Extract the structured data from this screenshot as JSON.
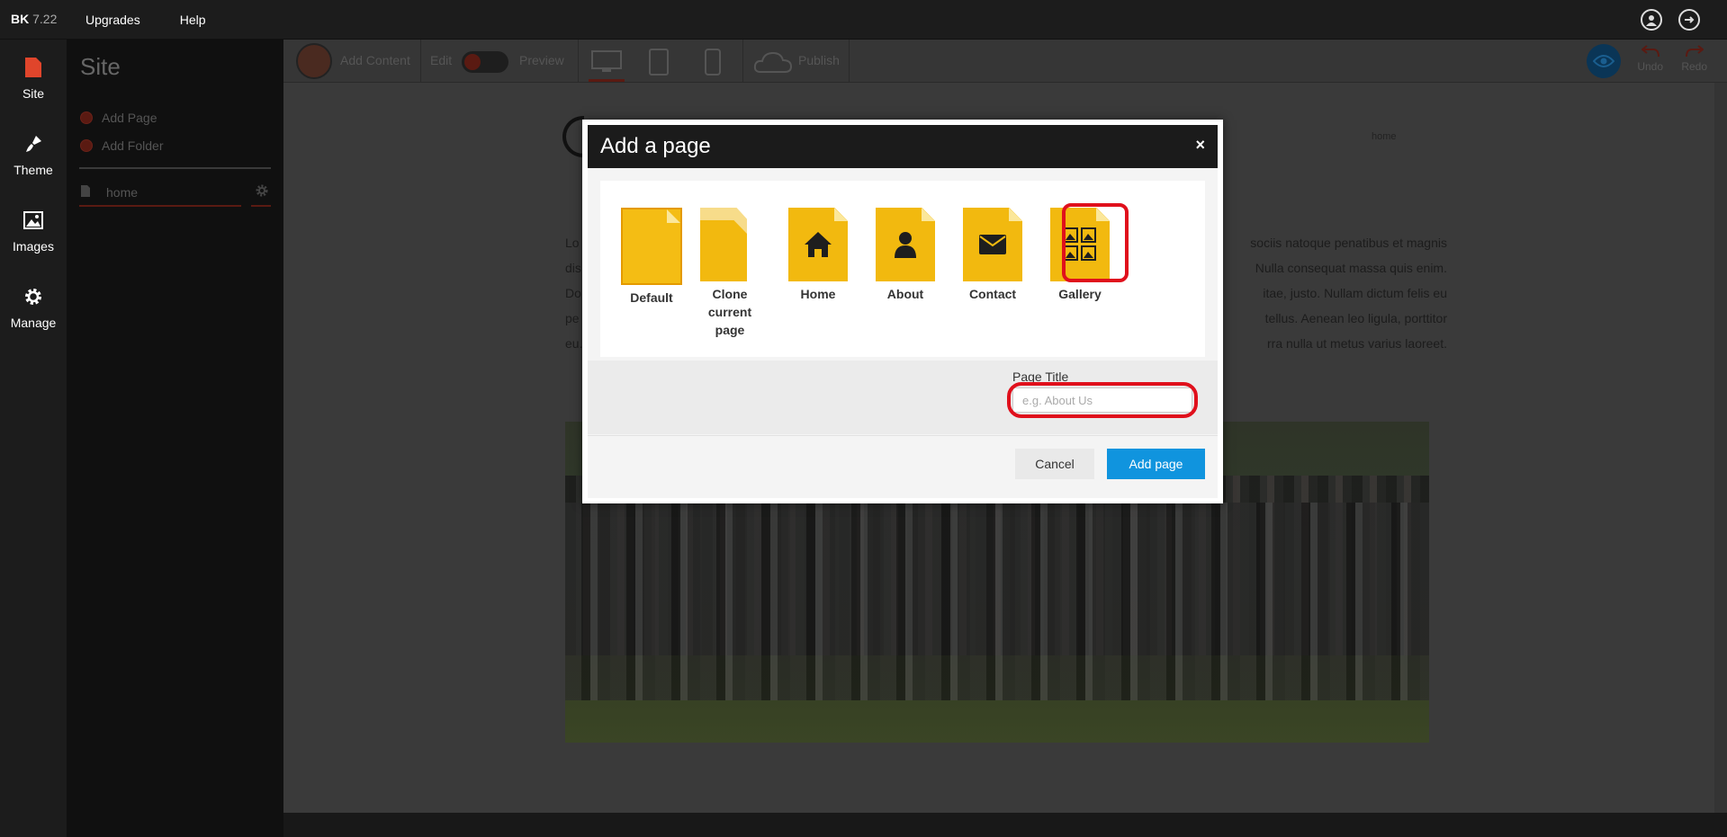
{
  "brand": {
    "short": "BK",
    "version": "7.22"
  },
  "topnav": {
    "upgrades": "Upgrades",
    "help": "Help"
  },
  "rail": {
    "site": "Site",
    "theme": "Theme",
    "images": "Images",
    "manage": "Manage"
  },
  "panel": {
    "title": "Site",
    "add_page": "Add Page",
    "add_folder": "Add Folder",
    "home_page": "home"
  },
  "toolbar": {
    "add_content": "Add Content",
    "edit": "Edit",
    "preview": "Preview",
    "publish": "Publish",
    "undo": "Undo",
    "redo": "Redo"
  },
  "page_preview": {
    "nav_home": "home",
    "lines_left": [
      "Lo",
      "dis",
      "Do",
      "pe",
      "eu."
    ],
    "lines_right": [
      "sociis natoque penatibus et magnis",
      "Nulla consequat massa quis enim.",
      "itae, justo. Nullam dictum felis eu",
      "tellus. Aenean leo ligula, porttitor",
      "rra nulla ut metus varius laoreet."
    ]
  },
  "modal": {
    "title": "Add a page",
    "close": "×",
    "templates": [
      {
        "label": "Default",
        "icon": "blank-page-icon"
      },
      {
        "label": "Clone current page",
        "icon": "clone-page-icon"
      },
      {
        "label": "Home",
        "icon": "home-icon"
      },
      {
        "label": "About",
        "icon": "person-icon"
      },
      {
        "label": "Contact",
        "icon": "envelope-icon"
      },
      {
        "label": "Gallery",
        "icon": "gallery-icon"
      }
    ],
    "page_title_label": "Page Title",
    "page_title_placeholder": "e.g. About Us",
    "page_title_value": "",
    "cancel": "Cancel",
    "add_page": "Add page"
  },
  "colors": {
    "accent_blue": "#1094de",
    "template_yellow": "#f2b90f",
    "highlight_red": "#e0101c",
    "brand_red": "#c0392b"
  }
}
